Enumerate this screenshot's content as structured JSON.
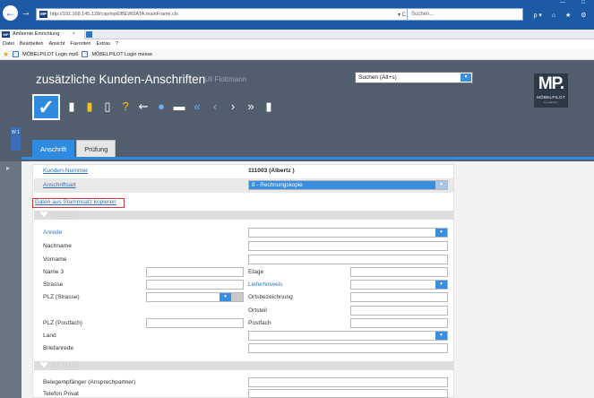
{
  "browser": {
    "address": "http://192.168.145.128/csp/mp6/BEWDATA.mainFrame.cls",
    "address_controls": "▾ C",
    "search_placeholder": "Suchen...",
    "window_controls": [
      "—",
      "□"
    ],
    "toolbar_icons": [
      "ρ ▾",
      "⌂",
      "★",
      "⚙"
    ],
    "tab_title": "Ambiente Einrichtung",
    "tab_close": "×",
    "menu": [
      "Datei",
      "Bearbeiten",
      "Ansicht",
      "Favoriten",
      "Extras",
      "?"
    ],
    "favorites": [
      "MÖBELPILOT Login mp6",
      "MÖBELPILOT Login messe"
    ]
  },
  "app": {
    "title": "zusätzliche Kunden-Anschriften",
    "user": "Uli Flottmann",
    "search_value": "Suchen (Alt+s)",
    "logo_text": "MP.",
    "logo_name": "MÖBELPILOT",
    "logo_sub": "by quantors",
    "side_tab": "W 1"
  },
  "tabs": [
    "Anschrift",
    "Prüfung"
  ],
  "form": {
    "kunden_nummer_label": "Kunden-Nummer",
    "kunden_nummer_value": "111003 (Albertz )",
    "anschriftsart_label": "Anschriftsart",
    "anschriftsart_value": "8 - Rechnungskopie",
    "copy_link": "Daten aus Stammsatz kopieren",
    "section_adresse": "Adresse",
    "section_erreichbar": "Erreichbar",
    "anrede": "Anrede",
    "nachname": "Nachname",
    "vorname": "Vorname",
    "name3": "Name 3",
    "etage": "Etage",
    "strasse": "Strasse",
    "lieferhinweis": "Lieferhinweis",
    "plz_strasse": "PLZ (Strasse)",
    "ortsbezeichnung": "Ortsbezeichnung",
    "ortsteil": "Ortsteil",
    "plz_postfach": "PLZ (Postfach)",
    "postfach": "Postfach",
    "land": "Land",
    "briefanrede": "Briefanrede",
    "belegempfaenger": "Belegempfänger (Ansprechpartner)",
    "telefon_privat": "Telefon Privat"
  },
  "colors": {
    "accent": "#2f8be0",
    "header": "#525d6e",
    "highlight": "#d23a3a"
  }
}
